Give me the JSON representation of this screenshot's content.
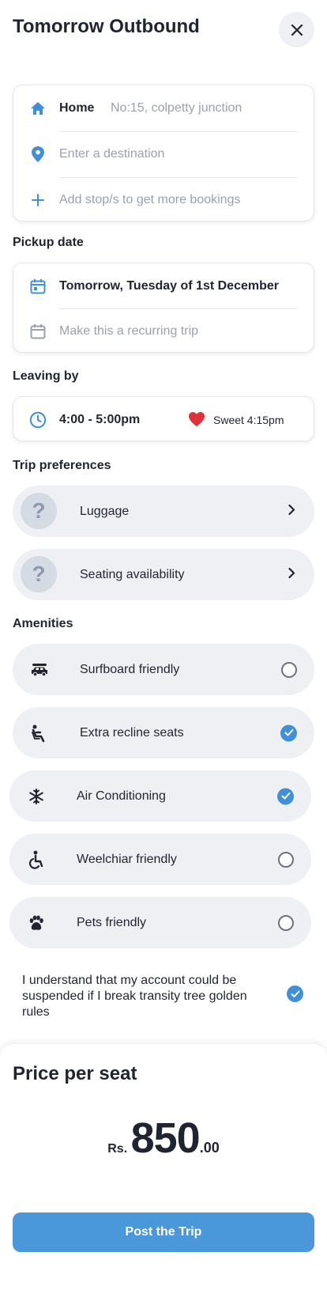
{
  "header": {
    "title": "Tomorrow Outbound",
    "close_icon": "close-icon"
  },
  "route": {
    "origin_label": "Home",
    "origin_address": "No:15, colpetty junction",
    "destination_placeholder": "Enter a destination",
    "add_stop_label": "Add stop/s to get more bookings"
  },
  "pickup": {
    "section_label": "Pickup date",
    "date_text": "Tomorrow, Tuesday of 1st December",
    "recurring_label": "Make this a recurring trip"
  },
  "leaving": {
    "section_label": "Leaving by",
    "time_range": "4:00 - 5:00pm",
    "sweet_time": "Sweet 4:15pm"
  },
  "preferences": {
    "section_label": "Trip preferences",
    "items": [
      {
        "label": "Luggage",
        "icon": "question-icon"
      },
      {
        "label": "Seating availability",
        "icon": "question-icon"
      }
    ]
  },
  "amenities": {
    "section_label": "Amenities",
    "items": [
      {
        "label": "Surfboard friendly",
        "icon": "car-surfboard-icon",
        "checked": false
      },
      {
        "label": "Extra recline seats",
        "icon": "recline-seat-icon",
        "checked": true
      },
      {
        "label": "Air Conditioning",
        "icon": "snowflake-icon",
        "checked": true
      },
      {
        "label": "Weelchiar friendly",
        "icon": "wheelchair-icon",
        "checked": false
      },
      {
        "label": "Pets friendly",
        "icon": "paw-icon",
        "checked": false
      }
    ]
  },
  "consent": {
    "text": "I understand that my account could be suspended if I break transity tree golden rules",
    "checked": true
  },
  "footer": {
    "price_title": "Price per seat",
    "currency": "Rs.",
    "amount": "850",
    "decimals": ".00",
    "post_button": "Post the Trip"
  },
  "colors": {
    "accent": "#4a97da",
    "check": "#3f8fdb",
    "heart": "#e0303a",
    "pill_bg": "#eef0f4"
  }
}
